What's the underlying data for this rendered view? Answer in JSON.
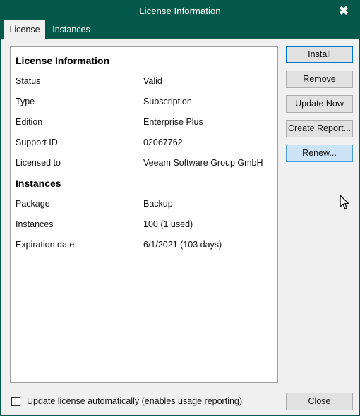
{
  "window": {
    "title": "License Information",
    "close_icon": "close-x-icon",
    "accent_green": "#04594a",
    "focus_blue": "#0078c8",
    "hover_blue": "#cce4f7"
  },
  "tabs": [
    {
      "label": "License",
      "active": true
    },
    {
      "label": "Instances",
      "active": false
    }
  ],
  "sections": [
    {
      "heading": "License Information",
      "rows": [
        {
          "label": "Status",
          "value": "Valid"
        },
        {
          "label": "Type",
          "value": "Subscription"
        },
        {
          "label": "Edition",
          "value": "Enterprise Plus"
        },
        {
          "label": "Support ID",
          "value": "02067762"
        },
        {
          "label": "Licensed to",
          "value": "Veeam Software Group GmbH"
        }
      ]
    },
    {
      "heading": "Instances",
      "rows": [
        {
          "label": "Package",
          "value": "Backup"
        },
        {
          "label": "Instances",
          "value": "100 (1 used)"
        },
        {
          "label": "Expiration date",
          "value": "6/1/2021 (103 days)"
        }
      ]
    }
  ],
  "side_buttons": [
    {
      "label": "Install",
      "state": "focused"
    },
    {
      "label": "Remove",
      "state": "normal"
    },
    {
      "label": "Update Now",
      "state": "normal"
    },
    {
      "label": "Create Report...",
      "state": "normal"
    },
    {
      "label": "Renew...",
      "state": "hover"
    }
  ],
  "footer": {
    "checkbox_label": "Update license automatically (enables usage reporting)",
    "checkbox_checked": false,
    "close_label": "Close"
  }
}
